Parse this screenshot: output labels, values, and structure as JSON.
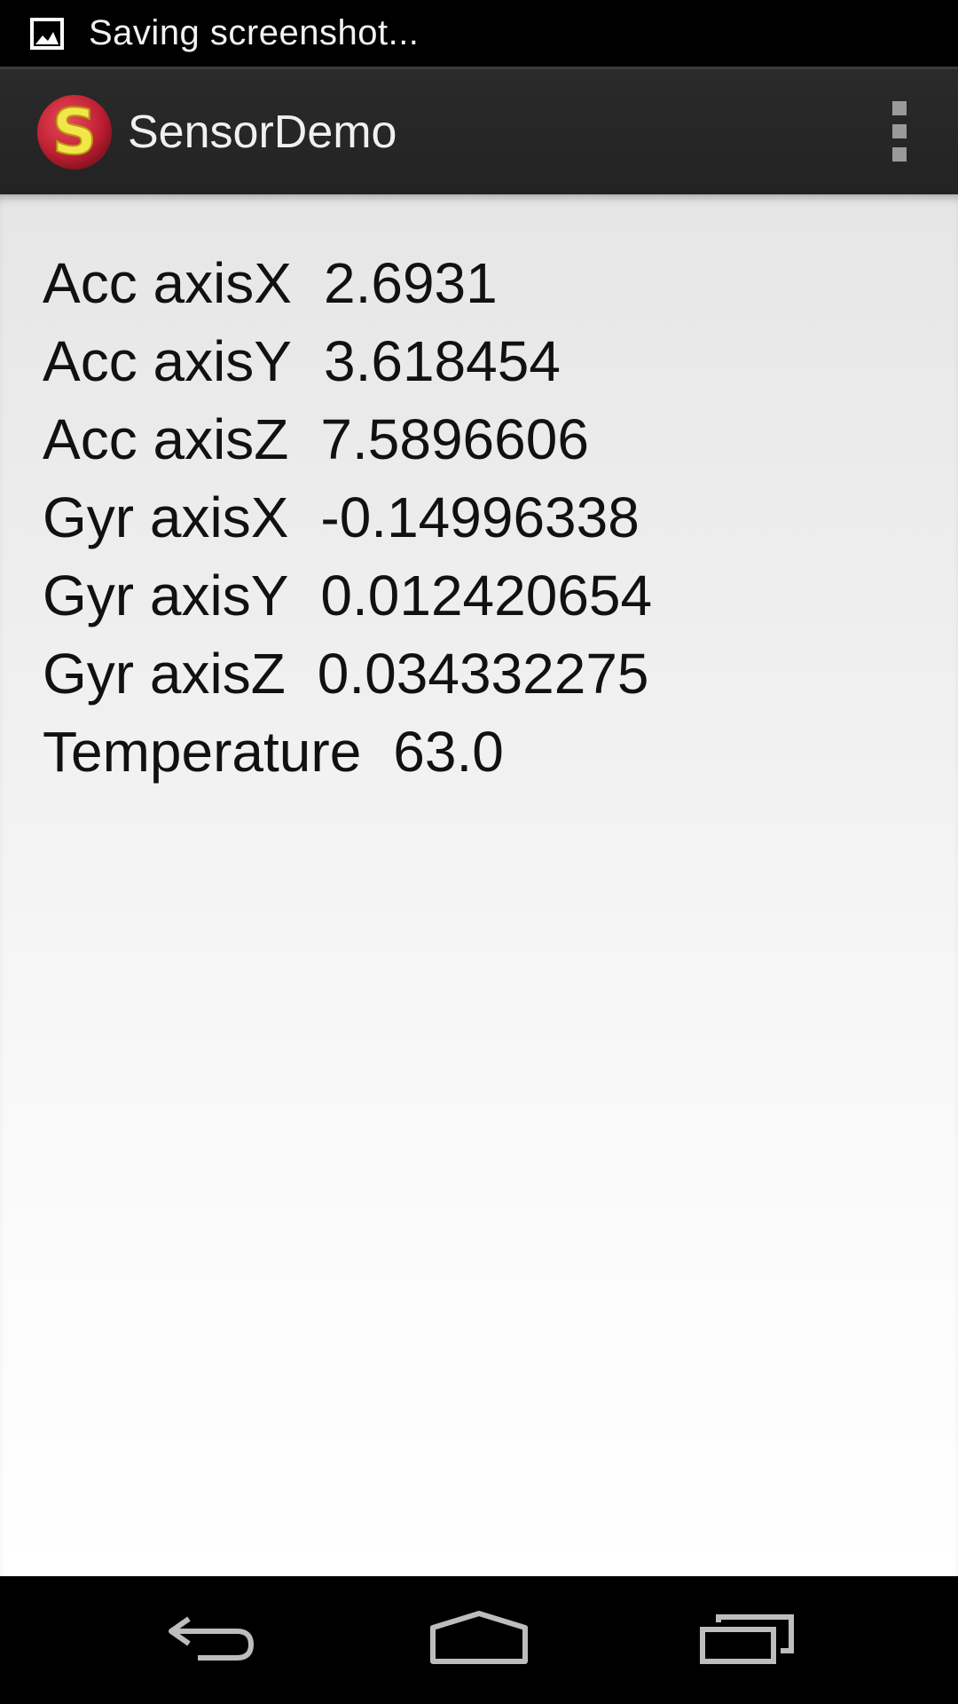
{
  "status_bar": {
    "icon": "image-icon",
    "notification_text": "Saving screenshot..."
  },
  "action_bar": {
    "app_icon": "app-logo-s-icon",
    "title": "SensorDemo",
    "overflow_icon": "overflow-menu-icon"
  },
  "sensors": [
    {
      "label": "Acc axisX",
      "value": "2.6931"
    },
    {
      "label": "Acc axisY",
      "value": "3.618454"
    },
    {
      "label": "Acc axisZ",
      "value": "7.5896606"
    },
    {
      "label": "Gyr axisX",
      "value": "-0.14996338"
    },
    {
      "label": "Gyr axisY",
      "value": "0.012420654"
    },
    {
      "label": "Gyr axisZ",
      "value": "0.034332275"
    },
    {
      "label": "Temperature",
      "value": "63.0"
    }
  ],
  "nav_bar": {
    "back_icon": "back-icon",
    "home_icon": "home-icon",
    "recents_icon": "recent-apps-icon"
  },
  "colors": {
    "status_bar_bg": "#000000",
    "action_bar_bg": "#262626",
    "content_bg_top": "#e6e6e6",
    "content_bg_bottom": "#ffffff",
    "text": "#111111",
    "app_icon_red": "#c8283a",
    "app_icon_yellow": "#f2e64a"
  }
}
